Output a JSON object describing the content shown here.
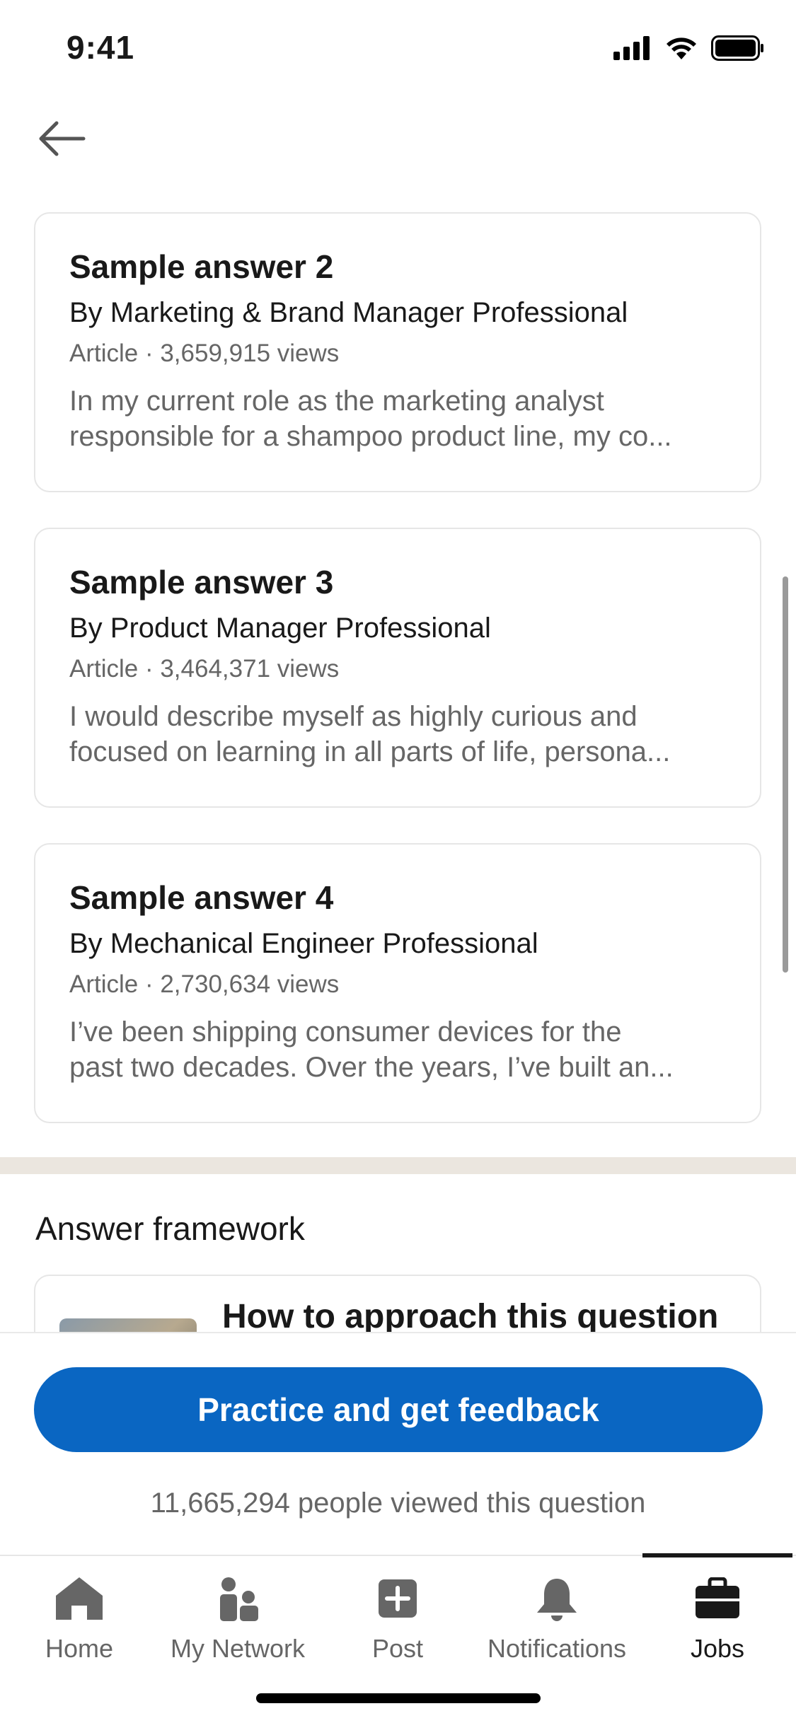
{
  "status_bar": {
    "time": "9:41"
  },
  "cards": [
    {
      "title": "Sample answer 2",
      "author": "By Marketing & Brand Manager Professional",
      "meta": "Article · 3,659,915 views",
      "snippet_line1": "In my current role as the marketing analyst",
      "snippet_line2": "responsible for a shampoo product line, my co..."
    },
    {
      "title": "Sample answer 3",
      "author": "By Product Manager Professional",
      "meta": "Article · 3,464,371 views",
      "snippet_line1": "I would describe myself as highly curious and",
      "snippet_line2": "focused on learning in all parts of life, persona..."
    },
    {
      "title": "Sample answer 4",
      "author": "By Mechanical Engineer Professional",
      "meta": "Article · 2,730,634 views",
      "snippet_line1": "I’ve been shipping consumer devices for the",
      "snippet_line2": "past two decades. Over the years, I’ve built an..."
    }
  ],
  "framework": {
    "section_title": "Answer framework",
    "card_title": "How to approach this question"
  },
  "action": {
    "button_label": "Practice and get feedback",
    "viewed_text": "11,665,294 people viewed this question"
  },
  "tabs": [
    {
      "label": "Home",
      "icon": "home-icon"
    },
    {
      "label": "My Network",
      "icon": "network-icon"
    },
    {
      "label": "Post",
      "icon": "post-icon"
    },
    {
      "label": "Notifications",
      "icon": "bell-icon"
    },
    {
      "label": "Jobs",
      "icon": "briefcase-icon",
      "active": true
    }
  ],
  "colors": {
    "primary": "#0a66c2",
    "text_primary": "#191919",
    "text_secondary": "#666666",
    "divider_band": "#ebe6df"
  }
}
